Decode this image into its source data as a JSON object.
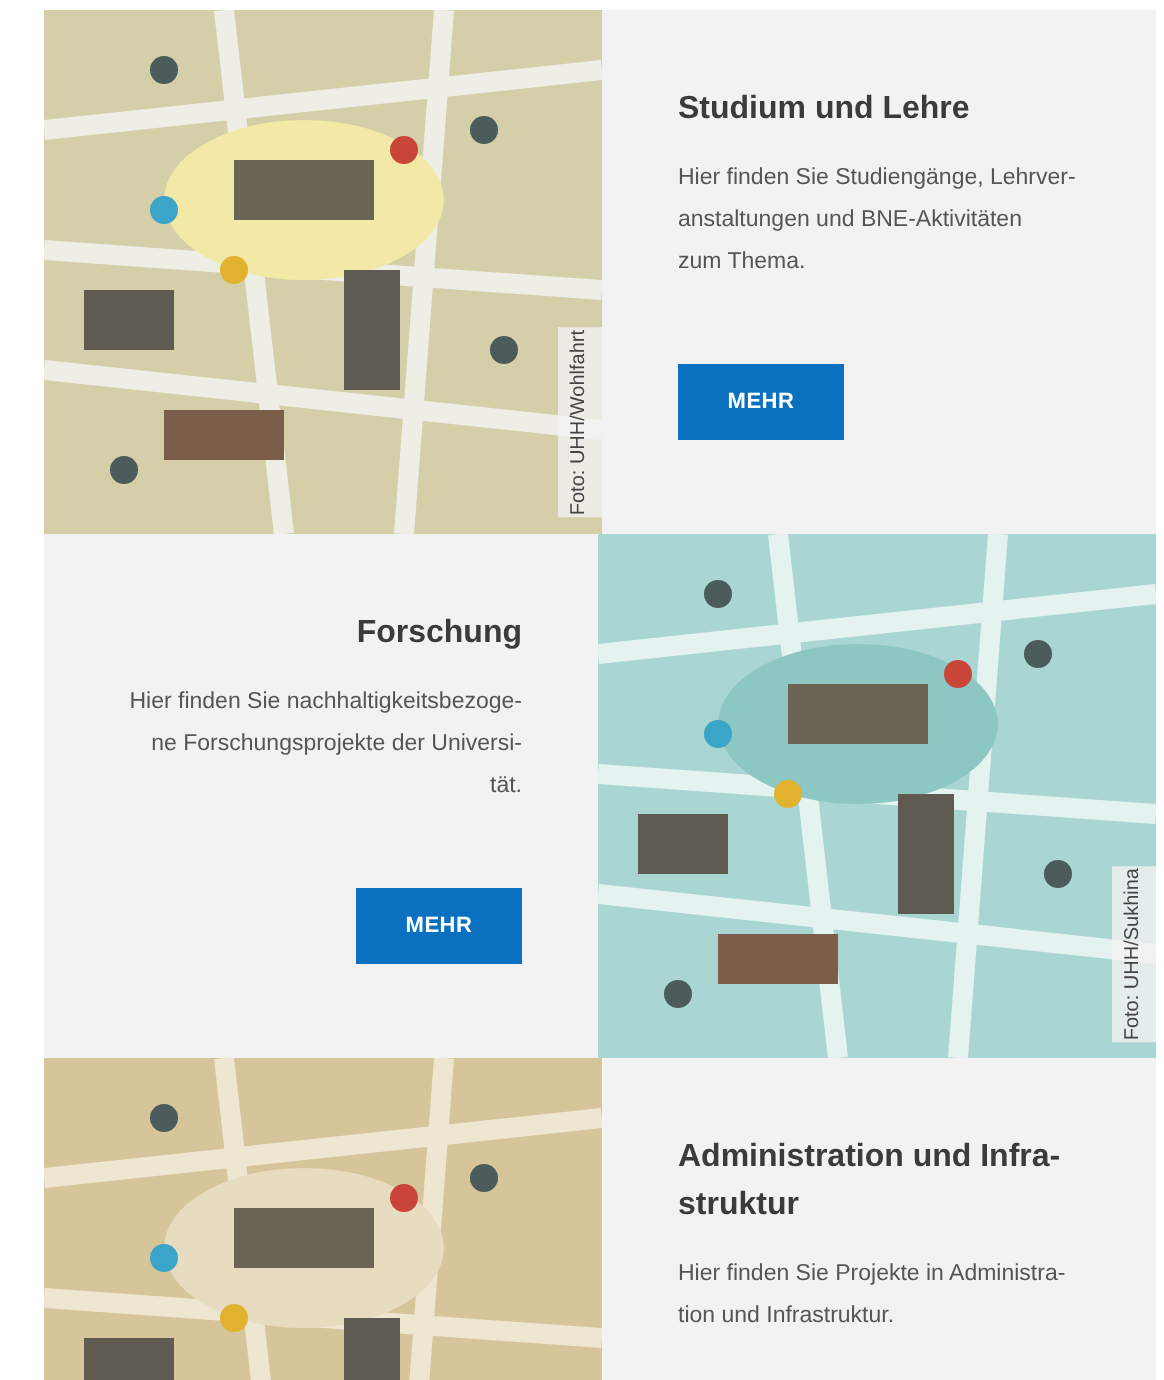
{
  "sections": [
    {
      "image_on_right": false,
      "image_credit": "Foto: UHH/Wohlfahrt",
      "title_lines": [
        "Studium und Lehre"
      ],
      "text_lines": [
        "Hier finden Sie Studiengänge, Lehrver-",
        "anstaltungen und BNE-Aktivitäten",
        "zum Thema."
      ],
      "button": "MEHR"
    },
    {
      "image_on_right": true,
      "image_credit": "Foto: UHH/Sukhina",
      "title_lines": [
        "Forschung"
      ],
      "text_lines": [
        "Hier finden Sie nachhaltigkeitsbezoge-",
        "ne Forschungsprojekte der Universi-",
        "tät."
      ],
      "button": "MEHR"
    },
    {
      "image_on_right": false,
      "title_lines": [
        "Administration und Infra-",
        "struktur"
      ],
      "text_lines": [
        "Hier finden Sie Projekte in Administra-",
        "tion und Infrastruktur."
      ]
    }
  ]
}
